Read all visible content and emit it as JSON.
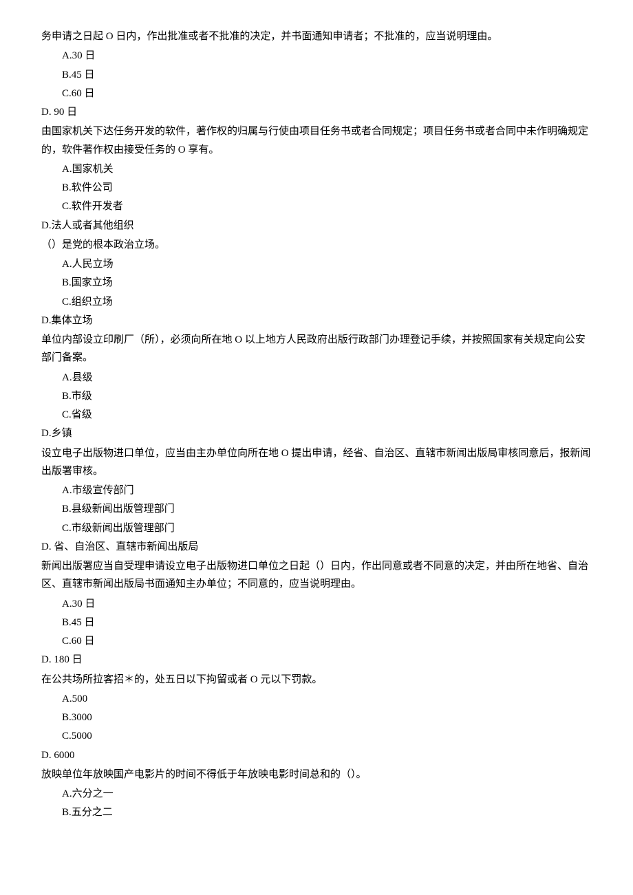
{
  "q1": {
    "continuation": "务申请之日起 O 日内，作出批准或者不批准的决定，并书面通知申请者；不批准的，应当说明理由。",
    "options": {
      "a": "A.30 日",
      "b": "B.45 日",
      "c": "C.60 日",
      "d": "D. 90 日"
    }
  },
  "q2": {
    "text": "由国家机关下达任务开发的软件，著作权的归属与行使由项目任务书或者合同规定；项目任务书或者合同中未作明确规定的，软件著作权由接受任务的 O 享有。",
    "options": {
      "a": "A.国家机关",
      "b": "B.软件公司",
      "c": "C.软件开发者",
      "d": "D.法人或者其他组织"
    }
  },
  "q3": {
    "text": "（）是党的根本政治立场。",
    "options": {
      "a": "A.人民立场",
      "b": "B.国家立场",
      "c": "C.组织立场",
      "d": "D.集体立场"
    }
  },
  "q4": {
    "text": "单位内部设立印刷厂（所），必须向所在地 O 以上地方人民政府出版行政部门办理登记手续，并按照国家有关规定向公安部门备案。",
    "options": {
      "a": "A.县级",
      "b": "B.市级",
      "c": "C.省级",
      "d": "D.乡镇"
    }
  },
  "q5": {
    "text": "设立电子出版物进口单位，应当由主办单位向所在地 O 提出申请，经省、自治区、直辖市新闻出版局审核同意后，报新闻出版署审核。",
    "options": {
      "a": "A.市级宣传部门",
      "b": "B.县级新闻出版管理部门",
      "c": "C.市级新闻出版管理部门",
      "d": "D. 省、自治区、直辖市新闻出版局"
    }
  },
  "q6": {
    "text": "新闻出版署应当自受理申请设立电子出版物进口单位之日起（）日内，作出同意或者不同意的决定，并由所在地省、自治区、直辖市新闻出版局书面通知主办单位；不同意的，应当说明理由。",
    "options": {
      "a": "A.30 日",
      "b": "B.45 日",
      "c": "C.60 日",
      "d": "D. 180 日"
    }
  },
  "q7": {
    "text": "在公共场所拉客招＊的，处五日以下拘留或者 O 元以下罚款。",
    "options": {
      "a": "A.500",
      "b": "B.3000",
      "c": "C.5000",
      "d": "D. 6000"
    }
  },
  "q8": {
    "text": "放映单位年放映国产电影片的时间不得低于年放映电影时间总和的（）。",
    "options": {
      "a": "A.六分之一",
      "b": "B.五分之二"
    }
  }
}
